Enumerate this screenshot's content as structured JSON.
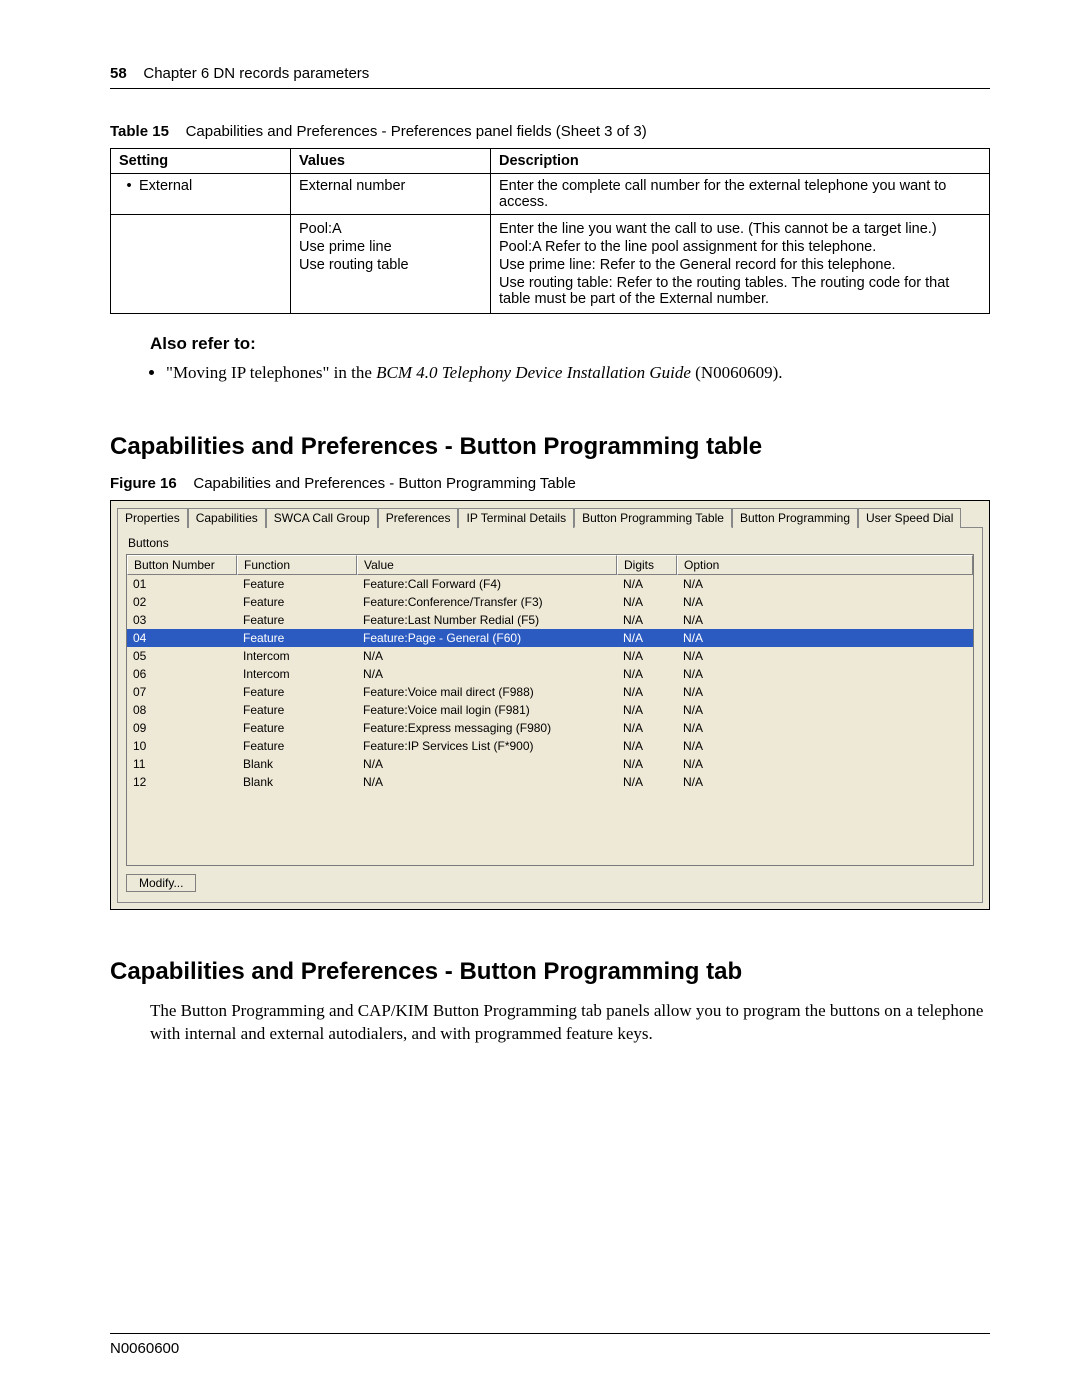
{
  "header": {
    "page_number": "58",
    "chapter_line": "Chapter 6  DN records parameters"
  },
  "table15": {
    "caption_label": "Table 15",
    "caption_text": "Capabilities and Preferences - Preferences panel fields (Sheet 3 of 3)",
    "columns": {
      "c1": "Setting",
      "c2": "Values",
      "c3": "Description"
    },
    "row1": {
      "setting": "External",
      "values": "External number",
      "desc": "Enter the complete call number for the external telephone you want to access."
    },
    "row2": {
      "values_l1": "Pool:A",
      "values_l2": "Use prime line",
      "values_l3": "Use routing table",
      "desc_l1": "Enter the line you want the call to use. (This cannot be a target line.)",
      "desc_l2": "Pool:A Refer to the line pool assignment for this telephone.",
      "desc_l3": "Use prime line: Refer to the General record for this telephone.",
      "desc_l4": "Use routing table: Refer to the routing tables. The routing code for that table must be part of the External number."
    }
  },
  "also_refer": {
    "heading": "Also refer to:",
    "item_prefix": "\"Moving IP telephones\" in the ",
    "item_italic": "BCM 4.0 Telephony Device Installation Guide",
    "item_suffix": " (N0060609)."
  },
  "section1": {
    "title": "Capabilities and Preferences - Button Programming table"
  },
  "figure16": {
    "caption_label": "Figure 16",
    "caption_text": "Capabilities and Preferences - Button Programming Table",
    "tabs": [
      "Properties",
      "Capabilities",
      "SWCA Call Group",
      "Preferences",
      "IP Terminal Details",
      "Button Programming Table",
      "Button Programming",
      "User Speed Dial"
    ],
    "active_tab_index": 5,
    "panel_label": "Buttons",
    "columns": [
      "Button Number",
      "Function",
      "Value",
      "Digits",
      "Option"
    ],
    "rows": [
      {
        "num": "01",
        "fn": "Feature",
        "val": "Feature:Call Forward (F4)",
        "dig": "N/A",
        "opt": "N/A",
        "sel": false
      },
      {
        "num": "02",
        "fn": "Feature",
        "val": "Feature:Conference/Transfer (F3)",
        "dig": "N/A",
        "opt": "N/A",
        "sel": false
      },
      {
        "num": "03",
        "fn": "Feature",
        "val": "Feature:Last Number Redial (F5)",
        "dig": "N/A",
        "opt": "N/A",
        "sel": false
      },
      {
        "num": "04",
        "fn": "Feature",
        "val": "Feature:Page - General (F60)",
        "dig": "N/A",
        "opt": "N/A",
        "sel": true
      },
      {
        "num": "05",
        "fn": "Intercom",
        "val": "N/A",
        "dig": "N/A",
        "opt": "N/A",
        "sel": false
      },
      {
        "num": "06",
        "fn": "Intercom",
        "val": "N/A",
        "dig": "N/A",
        "opt": "N/A",
        "sel": false
      },
      {
        "num": "07",
        "fn": "Feature",
        "val": "Feature:Voice mail direct (F988)",
        "dig": "N/A",
        "opt": "N/A",
        "sel": false
      },
      {
        "num": "08",
        "fn": "Feature",
        "val": "Feature:Voice mail login (F981)",
        "dig": "N/A",
        "opt": "N/A",
        "sel": false
      },
      {
        "num": "09",
        "fn": "Feature",
        "val": "Feature:Express messaging (F980)",
        "dig": "N/A",
        "opt": "N/A",
        "sel": false
      },
      {
        "num": "10",
        "fn": "Feature",
        "val": "Feature:IP Services List (F*900)",
        "dig": "N/A",
        "opt": "N/A",
        "sel": false
      },
      {
        "num": "11",
        "fn": "Blank",
        "val": "N/A",
        "dig": "N/A",
        "opt": "N/A",
        "sel": false
      },
      {
        "num": "12",
        "fn": "Blank",
        "val": "N/A",
        "dig": "N/A",
        "opt": "N/A",
        "sel": false
      }
    ],
    "modify_button": "Modify..."
  },
  "section2": {
    "title": "Capabilities and Preferences - Button Programming tab",
    "body": "The Button Programming and CAP/KIM Button Programming tab panels allow you to program the buttons on a telephone with internal and external autodialers, and with programmed feature keys."
  },
  "footer": {
    "doc_id": "N0060600"
  }
}
